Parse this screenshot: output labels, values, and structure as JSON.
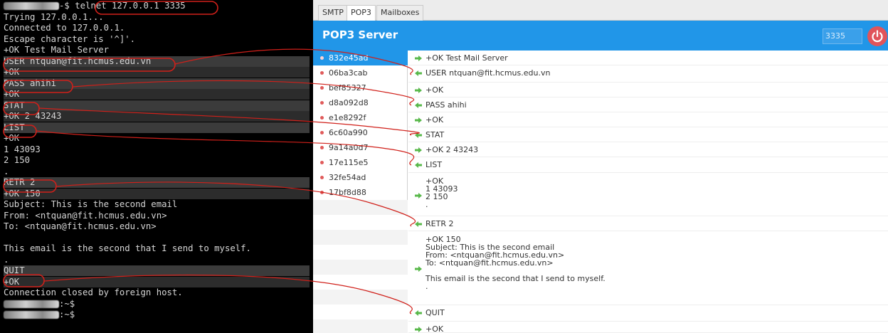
{
  "terminal": {
    "lines": [
      {
        "text": "-$ telnet 127.0.0.1 3335",
        "blur": true
      },
      {
        "text": "Trying 127.0.0.1..."
      },
      {
        "text": "Connected to 127.0.0.1."
      },
      {
        "text": "Escape character is '^]'."
      },
      {
        "text": "+OK Test Mail Server"
      },
      {
        "text": "USER ntquan@fit.hcmus.edu.vn",
        "sel": true
      },
      {
        "text": "+OK",
        "sel2": true
      },
      {
        "text": "PASS ahihi",
        "sel": true
      },
      {
        "text": "+OK",
        "sel2": true
      },
      {
        "text": "STAT",
        "sel": true
      },
      {
        "text": "+OK 2 43243",
        "sel2": true
      },
      {
        "text": "LIST",
        "sel": true
      },
      {
        "text": "+OK"
      },
      {
        "text": "1 43093"
      },
      {
        "text": "2 150"
      },
      {
        "text": "."
      },
      {
        "text": "RETR 2",
        "sel": true
      },
      {
        "text": "+OK 150",
        "sel2": true
      },
      {
        "text": "Subject: This is the second email"
      },
      {
        "text": "From: <ntquan@fit.hcmus.edu.vn>"
      },
      {
        "text": "To: <ntquan@fit.hcmus.edu.vn>"
      },
      {
        "text": ""
      },
      {
        "text": "This email is the second that I send to myself."
      },
      {
        "text": "."
      },
      {
        "text": "QUIT",
        "sel": true
      },
      {
        "text": "+OK",
        "sel2": true
      },
      {
        "text": "Connection closed by foreign host."
      },
      {
        "text": ":~$",
        "blur": true
      },
      {
        "text": ":~$",
        "blur": true
      }
    ]
  },
  "tabs": [
    {
      "label": "SMTP",
      "active": false
    },
    {
      "label": "POP3",
      "active": true
    },
    {
      "label": "Mailboxes",
      "active": false
    }
  ],
  "header": {
    "title": "POP3 Server",
    "port": "3335"
  },
  "sessions": [
    "832e45ad",
    "06ba3cab",
    "bef85327",
    "d8a092d8",
    "e1e8292f",
    "6c60a990",
    "9a14a0d7",
    "17e115e5",
    "32fe54ad",
    "17bf8d88"
  ],
  "messages": [
    {
      "dir": "out",
      "text": "+OK Test Mail Server"
    },
    {
      "dir": "in",
      "text": "USER ntquan@fit.hcmus.edu.vn"
    },
    {
      "dir": "out",
      "text": "+OK"
    },
    {
      "dir": "in",
      "text": "PASS ahihi"
    },
    {
      "dir": "out",
      "text": "+OK"
    },
    {
      "dir": "in",
      "text": "STAT"
    },
    {
      "dir": "out",
      "text": "+OK 2 43243"
    },
    {
      "dir": "in",
      "text": "LIST"
    },
    {
      "dir": "out",
      "text": "+OK\n1 43093\n2 150\n."
    },
    {
      "dir": "in",
      "text": "RETR 2"
    },
    {
      "dir": "out",
      "text": "+OK 150\nSubject: This is the second email\nFrom: <ntquan@fit.hcmus.edu.vn>\nTo: <ntquan@fit.hcmus.edu.vn>\n\nThis email is the second that I send to myself.\n."
    },
    {
      "dir": "in",
      "text": "QUIT"
    },
    {
      "dir": "out",
      "text": "+OK"
    }
  ],
  "colors": {
    "header": "#2196e8",
    "power": "#e0545a",
    "arrow": "#58b84a",
    "annotation": "#d0201a"
  }
}
